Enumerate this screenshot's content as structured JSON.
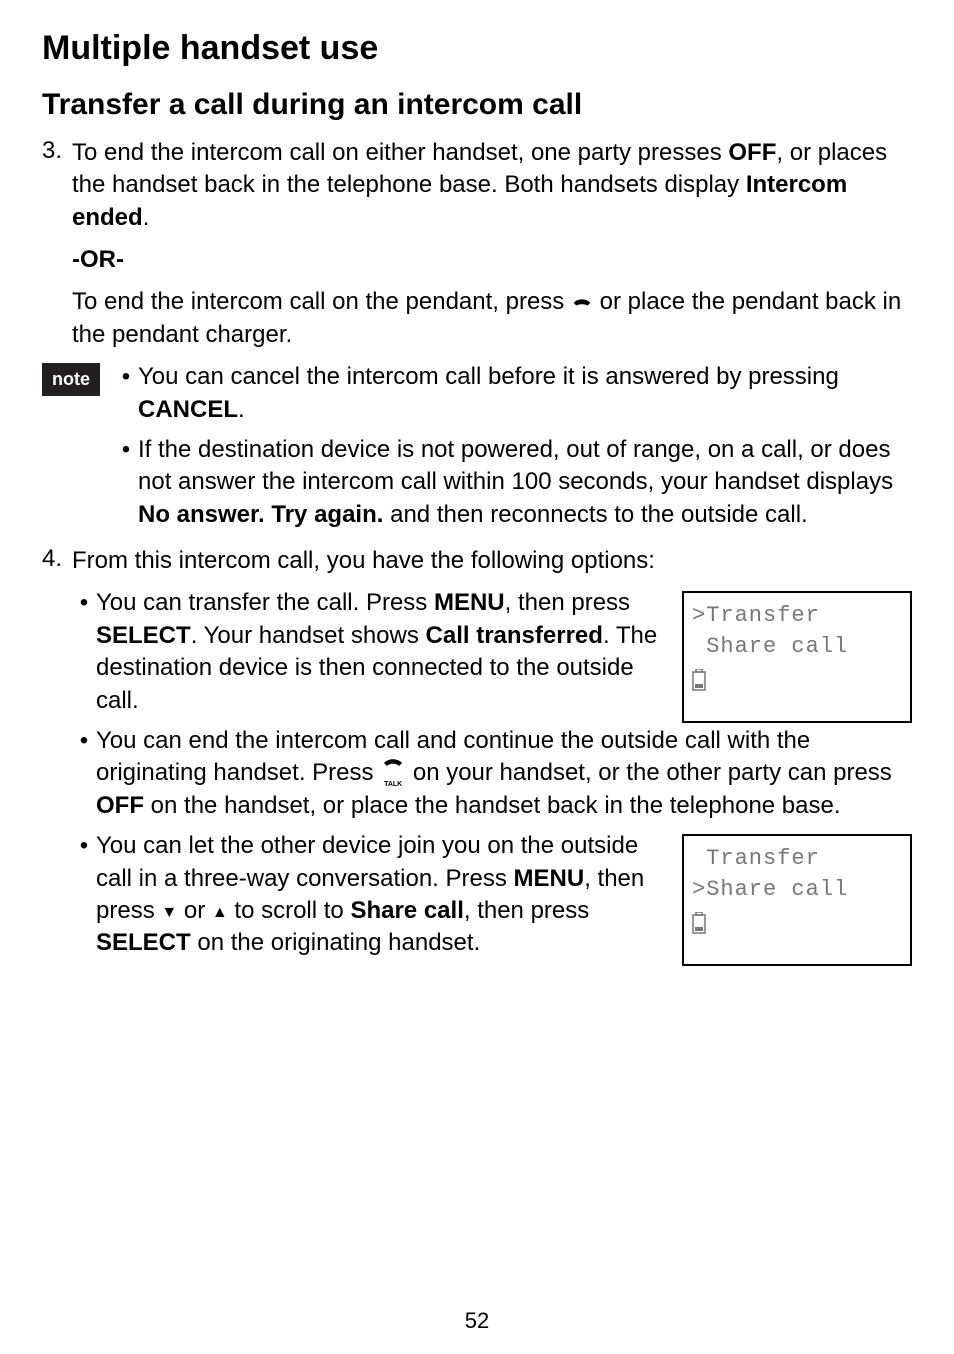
{
  "page": {
    "title": "Multiple handset use",
    "section": "Transfer a call during an intercom call",
    "number": "52"
  },
  "step3": {
    "num": "3.",
    "pre": "To end the intercom call on either handset, one party presses ",
    "off": "OFF",
    "mid": ", or places the handset back in the telephone base. Both handsets display ",
    "ended": "Intercom ended",
    "post": ".",
    "or": "-OR-",
    "pendant_pre": "To end the intercom call on the pendant, press ",
    "pendant_post": " or place the pendant back in the pendant charger."
  },
  "note": {
    "label": "note",
    "b1_pre": "You can cancel the intercom call before it is answered by pressing ",
    "b1_cancel": "CANCEL",
    "b1_post": ".",
    "b2_pre": "If the destination device is not powered, out of range, on a call, or does not answer the intercom call within 100 seconds, your handset displays ",
    "b2_noans": "No answer. Try again.",
    "b2_post": " and then reconnects to the outside call."
  },
  "step4": {
    "num": "4.",
    "intro": "From this intercom call, you have the following options:",
    "s1_p1": "You can transfer the call. Press ",
    "s1_menu": "MENU",
    "s1_p2": ", then press ",
    "s1_select": "SELECT",
    "s1_p3": ". Your handset shows ",
    "s1_ct": "Call transferred",
    "s1_p4": ". The destination device is then connected to the outside call.",
    "s2_p1": "You can end the intercom call and continue the outside call with the originating handset. Press ",
    "s2_p2": " on your handset, or the other party can press ",
    "s2_off": "OFF",
    "s2_p3": " on the handset, or place the handset back in the telephone base.",
    "s3_p1": "You can let the other device join you on the outside call in a three-way conversation. Press ",
    "s3_menu": "MENU",
    "s3_p2": ", then press ",
    "s3_or": " or ",
    "s3_p3": " to scroll to ",
    "s3_share": "Share call",
    "s3_p4": ", then press ",
    "s3_select": "SELECT",
    "s3_p5": " on the originating handset."
  },
  "lcd1": {
    "line1": ">Transfer",
    "line2": " Share call"
  },
  "lcd2": {
    "line1": " Transfer",
    "line2": ">Share call"
  },
  "icons": {
    "talk": "TALK",
    "down": "▼",
    "up": "▲"
  }
}
